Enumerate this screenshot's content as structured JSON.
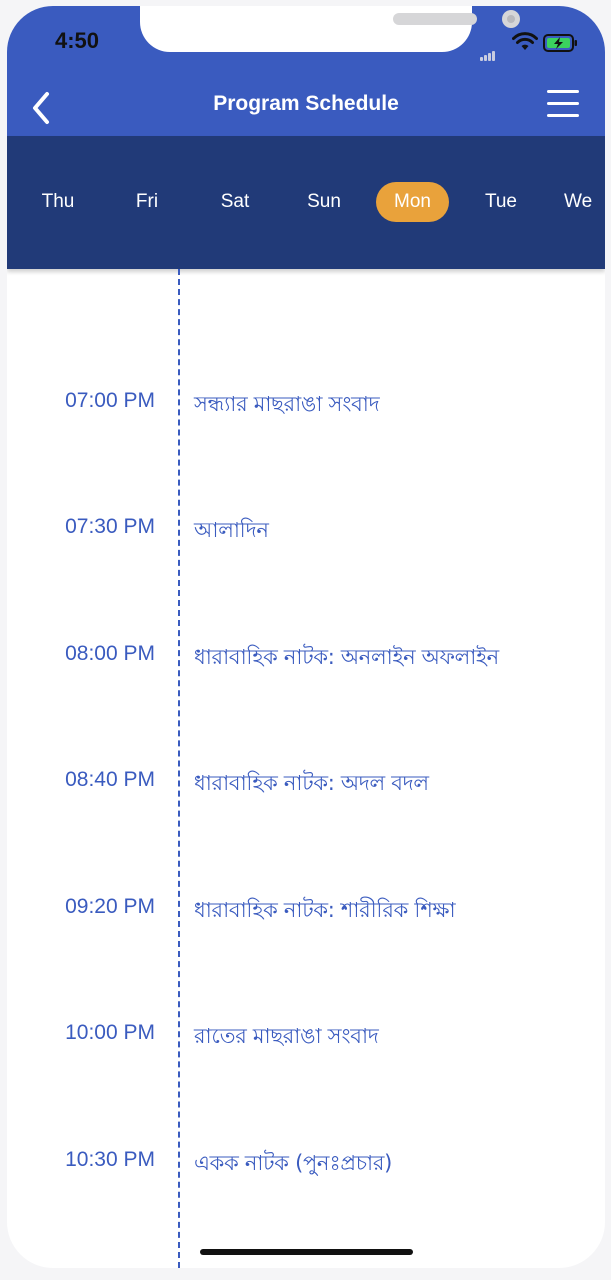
{
  "status_bar": {
    "time": "4:50"
  },
  "header": {
    "title": "Program Schedule"
  },
  "days": [
    {
      "label": "Thu",
      "active": false
    },
    {
      "label": "Fri",
      "active": false
    },
    {
      "label": "Sat",
      "active": false
    },
    {
      "label": "Sun",
      "active": false
    },
    {
      "label": "Mon",
      "active": true
    },
    {
      "label": "Tue",
      "active": false
    },
    {
      "label": "We",
      "active": false
    }
  ],
  "schedule": [
    {
      "time": "07:00 PM",
      "title": "সন্ধ্যার মাছরাঙা সংবাদ"
    },
    {
      "time": "07:30 PM",
      "title": "আলাদিন"
    },
    {
      "time": "08:00 PM",
      "title": "ধারাবাহিক নাটক: অনলাইন অফলাইন"
    },
    {
      "time": "08:40 PM",
      "title": "ধারাবাহিক নাটক: অদল বদল"
    },
    {
      "time": "09:20 PM",
      "title": "ধারাবাহিক নাটক: শারীরিক শিক্ষা"
    },
    {
      "time": "10:00 PM",
      "title": "রাতের মাছরাঙা সংবাদ"
    },
    {
      "time": "10:30 PM",
      "title": "একক নাটক (পুনঃপ্রচার)"
    }
  ],
  "colors": {
    "header_bg": "#3a5bbf",
    "daybar_bg": "#213a78",
    "active_day": "#e9a23b",
    "text_accent": "#3a5bbf"
  },
  "icons": [
    "back-chevron-icon",
    "hamburger-menu-icon",
    "signal-icon",
    "wifi-icon",
    "battery-charging-icon"
  ]
}
